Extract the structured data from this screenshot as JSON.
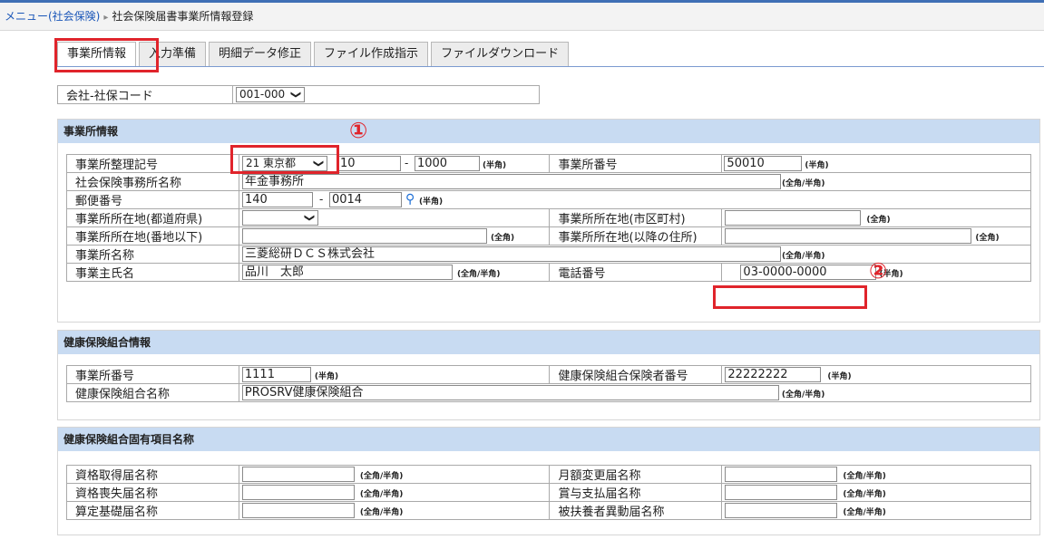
{
  "breadcrumb": {
    "menu_link": "メニュー(社会保険)",
    "separator": "▸",
    "current": "社会保険届書事業所情報登録"
  },
  "tabs": [
    {
      "label": "事業所情報",
      "active": true
    },
    {
      "label": "入力準備"
    },
    {
      "label": "明細データ修正"
    },
    {
      "label": "ファイル作成指示"
    },
    {
      "label": "ファイルダウンロード"
    }
  ],
  "company": {
    "label": "会社-社保コード",
    "value": "001-000"
  },
  "callouts": {
    "one": "①",
    "two": "②"
  },
  "office": {
    "title": "事業所情報",
    "seiri_label": "事業所整理記号",
    "seiri_pref": "21 東京都",
    "seiri_code1": "10",
    "seiri_dash": "-",
    "seiri_code2": "1000",
    "hankaku": "(半角)",
    "bango_label": "事業所番号",
    "bango_value": "50010",
    "jimusho_label": "社会保険事務所名称",
    "jimusho_value": "年金事務所",
    "zenhan": "(全角/半角)",
    "yubin_label": "郵便番号",
    "yubin1": "140",
    "yubin_dash": "-",
    "yubin2": "0014",
    "pref_label": "事業所所在地(都道府県)",
    "city_label": "事業所所在地(市区町村)",
    "zenkaku": "(全角)",
    "banchi_label": "事業所所在地(番地以下)",
    "ikou_label": "事業所所在地(以降の住所)",
    "name_label": "事業所名称",
    "name_value": "三菱総研ＤＣＳ株式会社",
    "owner_label": "事業主氏名",
    "owner_value": "品川　太郎",
    "tel_label": "電話番号",
    "tel_value": "03-0000-0000"
  },
  "kenpo": {
    "title": "健康保険組合情報",
    "bango_label": "事業所番号",
    "bango_value": "1111",
    "hokensha_label": "健康保険組合保険者番号",
    "hokensha_value": "22222222",
    "name_label": "健康保険組合名称",
    "name_value": "PROSRV健康保険組合"
  },
  "koyu": {
    "title": "健康保険組合固有項目名称",
    "rows": [
      {
        "left": "資格取得届名称",
        "right": "月額変更届名称"
      },
      {
        "left": "資格喪失届名称",
        "right": "賞与支払届名称"
      },
      {
        "left": "算定基礎届名称",
        "right": "被扶養者異動届名称"
      }
    ]
  }
}
